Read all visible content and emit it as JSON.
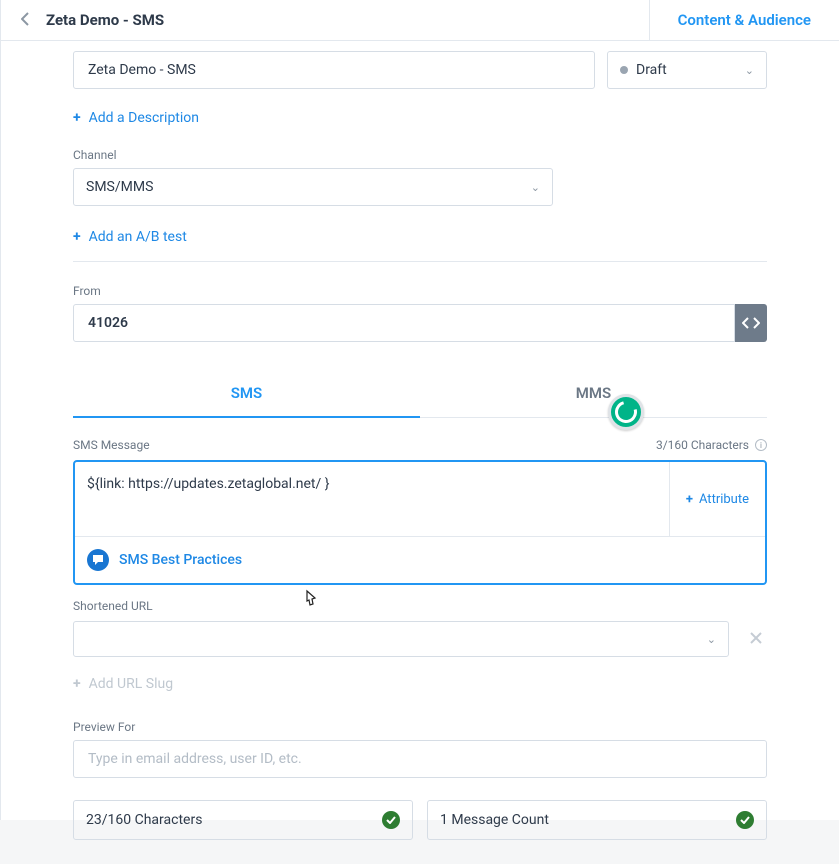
{
  "header": {
    "title": "Zeta Demo - SMS",
    "cta_tab": "Content & Audience"
  },
  "name_field": {
    "value": "Zeta Demo - SMS"
  },
  "status": {
    "value": "Draft"
  },
  "add_description": "Add a Description",
  "channel": {
    "label": "Channel",
    "value": "SMS/MMS"
  },
  "add_ab": "Add an A/B test",
  "from": {
    "label": "From",
    "value": "41026"
  },
  "tabs": {
    "sms": "SMS",
    "mms": "MMS"
  },
  "sms_message": {
    "label": "SMS Message",
    "char_text": "3/160 Characters",
    "text": "${link: https://updates.zetaglobal.net/ }",
    "attribute_btn": "Attribute",
    "best_practices": "SMS Best Practices"
  },
  "shortened_url": {
    "label": "Shortened URL"
  },
  "add_slug": "Add URL Slug",
  "preview": {
    "label": "Preview For",
    "placeholder": "Type in email address, user ID, etc."
  },
  "counter": {
    "chars": "23/160 Characters",
    "msgs": "1 Message Count"
  }
}
